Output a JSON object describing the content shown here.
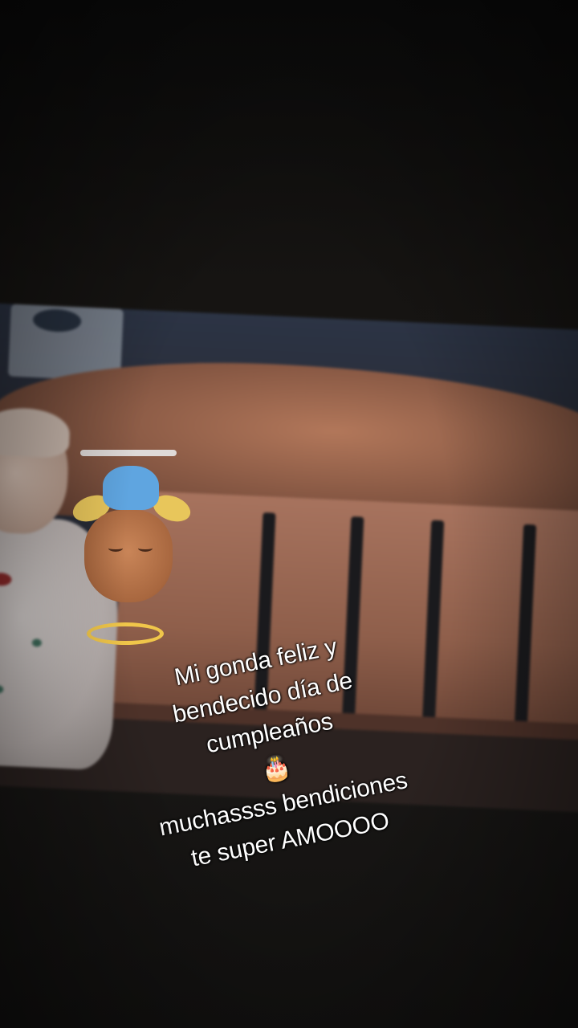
{
  "caption": {
    "line1": "Mi gonda feliz y",
    "line2": "bendecido día de",
    "line3_text": "cumpleaños",
    "line3_emoji": "🎂",
    "line4": "muchassss bendiciones",
    "line5": "te super AMOOOO"
  },
  "sticker_icon": "angel-bee-sticker",
  "photo_subject": "baby-in-crib-photo",
  "colors": {
    "background": "#0d0c0b",
    "caption_text": "#ffffff",
    "halo": "#f0c64a"
  }
}
